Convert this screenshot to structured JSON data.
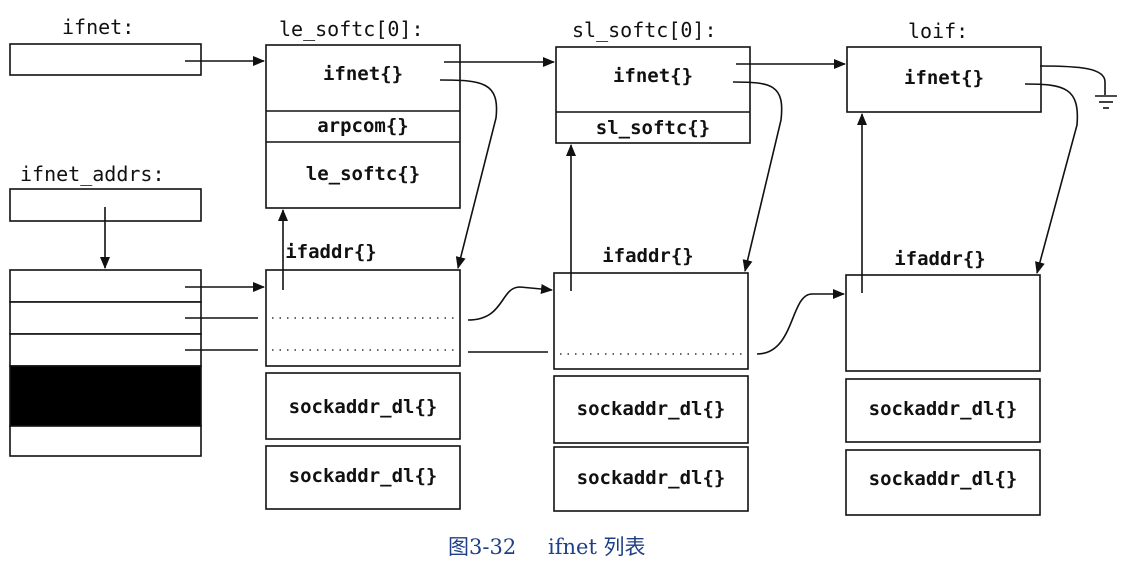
{
  "labels": {
    "ifnet_head": "ifnet:",
    "ifnet_addrs_head": "ifnet_addrs:",
    "le_softc_title": "le_softc[0]:",
    "sl_softc_title": "sl_softc[0]:",
    "loif_title": "loif:"
  },
  "structs": {
    "le": {
      "ifnet": "ifnet{}",
      "arpcom": "arpcom{}",
      "softc": "le_softc{}"
    },
    "sl": {
      "ifnet": "ifnet{}",
      "softc": "sl_softc{}"
    },
    "lo": {
      "ifnet": "ifnet{}"
    }
  },
  "ifaddr": {
    "le": "ifaddr{}",
    "sl": "ifaddr{}",
    "lo": "ifaddr{}"
  },
  "sockaddr": {
    "le": [
      "sockaddr_dl{}",
      "sockaddr_dl{}"
    ],
    "sl": [
      "sockaddr_dl{}",
      "sockaddr_dl{}"
    ],
    "lo": [
      "sockaddr_dl{}",
      "sockaddr_dl{}"
    ]
  },
  "caption": {
    "figure": "图3-32",
    "title": "ifnet 列表"
  },
  "colors": {
    "line": "#111111",
    "caption": "#1f3f86",
    "filled_slot": "#000000"
  }
}
